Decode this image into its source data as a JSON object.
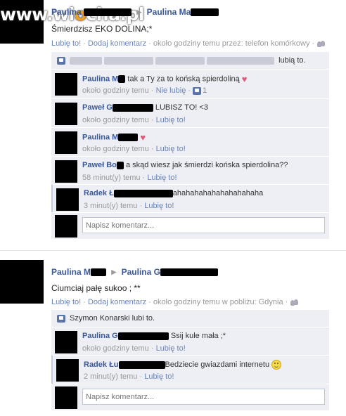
{
  "watermark": {
    "prefix": "www.wi",
    "o": "o",
    "suffix": "cha.pl"
  },
  "posts": [
    {
      "author": "Paulina",
      "target": "Paulina Ma",
      "text": "Śmierdzisz EKO DOLINA;*",
      "meta": {
        "like": "Lubię to!",
        "comment": "Dodaj komentarz",
        "time": "około godziny temu przez: telefon komórkowy"
      },
      "likes_suffix": "lubią to.",
      "comments": [
        {
          "name": "Paulina M",
          "text": "tak a Ty za to końską spierdoliną",
          "time": "około godziny temu",
          "action": "Nie lubię",
          "count": "1"
        },
        {
          "name": "Paweł G",
          "text": "LUBISZ TO! <3",
          "time": "około godziny temu",
          "action": "Lubię to!"
        },
        {
          "name": "Paulina M",
          "text": "",
          "time": "około godziny temu",
          "action": "Lubię to!"
        },
        {
          "name": "Paweł Bo",
          "text": "a skąd wiesz jak śmierdzi końska spierdolina??",
          "time": "58 minut(y) temu",
          "action": "Lubię to!"
        },
        {
          "name": "Radek Ł",
          "text": "ahahahahahahahahahaha",
          "time": "3 minut(y) temu",
          "action": "Lubię to!"
        }
      ],
      "write_placeholder": "Napisz komentarz..."
    },
    {
      "author": "Paulina M",
      "target": "Paulina G",
      "text": "Ciumciaj pałę sukoo ; **",
      "meta": {
        "like": "Lubię to!",
        "comment": "Dodaj komentarz",
        "time": "około godziny temu w pobliżu: Gdynia"
      },
      "likes_text": "Szymon Konarski lubi to.",
      "comments": [
        {
          "name": "Paulina G",
          "text": "Ssij kule mała ;*",
          "time": "około godziny temu",
          "action": "Lubię to!"
        },
        {
          "name": "Radek Łu",
          "text": "Bedziecie gwiazdami internetu",
          "time": "2 minut(y) temu",
          "action": "Lubię to!"
        }
      ],
      "write_placeholder": "Napisz komentarz..."
    }
  ]
}
